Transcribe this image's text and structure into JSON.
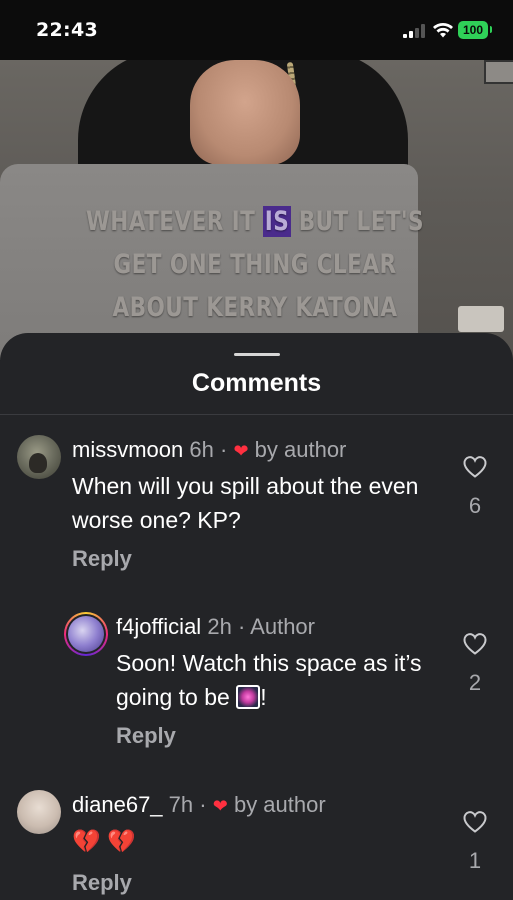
{
  "status_bar": {
    "time": "22:43",
    "battery": "100"
  },
  "video": {
    "caption_before": "WHATEVER IT ",
    "caption_highlight": "IS",
    "caption_after": " BUT LET'S GET ONE THING CLEAR ABOUT KERRY KATONA"
  },
  "sheet": {
    "title": "Comments"
  },
  "comments": [
    {
      "username": "missvmoon",
      "time": "6h",
      "separator": "·",
      "liked_by": "by author",
      "text": "When will you spill about the even worse one? KP?",
      "reply_label": "Reply",
      "likes": "6"
    },
    {
      "username": "f4jofficial",
      "time": "2h",
      "separator": "·",
      "role": "Author",
      "text_before": "Soon! Watch this space as it’s going to be ",
      "text_after": "!",
      "reply_label": "Reply",
      "likes": "2"
    },
    {
      "username": "diane67_",
      "time": "7h",
      "separator": "·",
      "liked_by": "by author",
      "text": "💔 💔",
      "reply_label": "Reply",
      "likes": "1"
    }
  ],
  "colors": {
    "heart": "#ff3040",
    "sheet_bg": "#232427",
    "battery": "#2fd158",
    "caption_highlight": "#4a2b8c"
  }
}
